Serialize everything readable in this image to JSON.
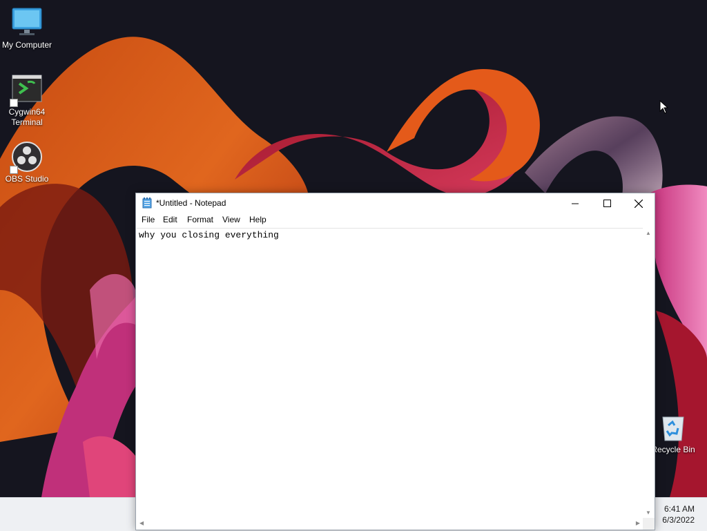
{
  "desktop": {
    "icons": [
      {
        "label": "My Computer",
        "icon": "monitor-icon"
      },
      {
        "label": "Cygwin64 Terminal",
        "icon": "terminal-icon"
      },
      {
        "label": "OBS Studio",
        "icon": "obs-icon"
      },
      {
        "label": "Recycle Bin",
        "icon": "recycle-bin-icon"
      }
    ]
  },
  "notepad": {
    "title": "*Untitled - Notepad",
    "menu": [
      "File",
      "Edit",
      "Format",
      "View",
      "Help"
    ],
    "content": "why you closing everything"
  },
  "taskbar": {
    "time": "6:41 AM",
    "date": "6/3/2022"
  },
  "colors": {
    "wallpaper_bg": "#14141f",
    "ribbon_orange": "#d9531a",
    "ribbon_red": "#b01e2c",
    "ribbon_pink": "#d0408a",
    "taskbar_bg": "#eef0f3"
  }
}
